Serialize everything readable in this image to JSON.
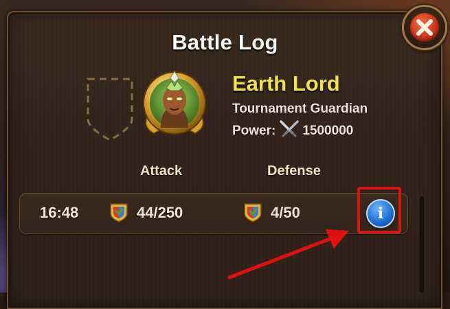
{
  "window": {
    "title": "Battle Log"
  },
  "boss": {
    "name": "Earth Lord",
    "subtitle": "Tournament Guardian",
    "power_label": "Power:",
    "power_value": "1500000"
  },
  "columns": {
    "attack": "Attack",
    "defense": "Defense"
  },
  "log": [
    {
      "time": "16:48",
      "attack": "44/250",
      "defense": "4/50",
      "info_icon": "info-icon"
    }
  ],
  "icons": {
    "close": "close-icon",
    "swords": "crossed-swords-icon",
    "badge": "shield-emblem-icon",
    "info": "info-icon",
    "empty_slot": "empty-shield-slot-icon",
    "annotation_arrow": "red-arrow-annotation"
  },
  "colors": {
    "accent_yellow": "#f2e24a",
    "close_red": "#cf3518",
    "info_blue": "#1f72d6",
    "highlight_red": "#e11010"
  }
}
